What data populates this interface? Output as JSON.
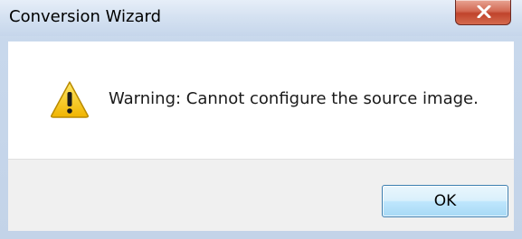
{
  "window": {
    "title": "Conversion Wizard",
    "close_icon": "close-x-icon"
  },
  "dialog": {
    "icon": "warning-triangle-icon",
    "message": "Warning: Cannot configure the source image.",
    "ok_label": "OK"
  },
  "colors": {
    "warning_yellow": "#f5c400",
    "close_red": "#c9452d",
    "ok_border": "#3c7fb1"
  }
}
